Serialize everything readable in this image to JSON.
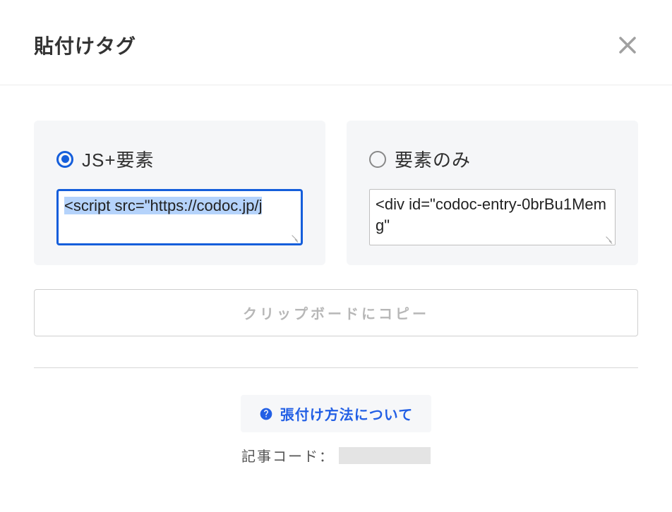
{
  "header": {
    "title": "貼付けタグ"
  },
  "options": {
    "jsElement": {
      "label": "JS+要素",
      "selected": true,
      "code": "<script src=\"https://codoc.jp/j"
    },
    "elementOnly": {
      "label": "要素のみ",
      "selected": false,
      "code": "<div id=\"codoc-entry-0brBu1Memg\""
    }
  },
  "copyButton": {
    "label": "クリップボードにコピー"
  },
  "helpLink": {
    "label": "張付け方法について"
  },
  "articleCode": {
    "label": "記事コード：",
    "value": ""
  }
}
